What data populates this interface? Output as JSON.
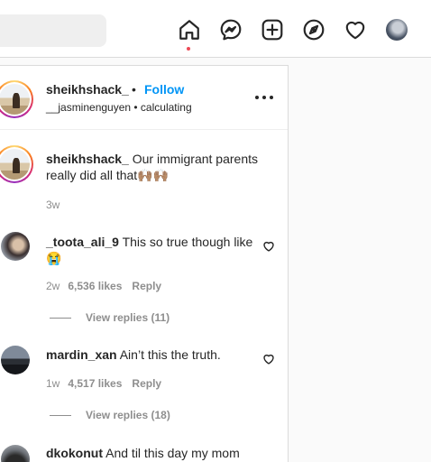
{
  "topbar": {
    "icons": [
      "home-icon",
      "messenger-icon",
      "new-post-icon",
      "explore-icon",
      "activity-heart-icon",
      "profile-avatar"
    ]
  },
  "post": {
    "header": {
      "username": "sheikhshack_",
      "separator": "•",
      "follow_label": "Follow",
      "subtitle": "__jasminenguyen • calculating"
    },
    "caption": {
      "username": "sheikhshack_",
      "text": "Our immigrant parents really did all that🙌🏽🙌🏽",
      "time": "3w"
    },
    "comments": [
      {
        "username": "_toota_ali_9",
        "text": "This so true though like 😭",
        "time": "2w",
        "likes": "6,536 likes",
        "reply_label": "Reply",
        "view_replies": "View replies (11)"
      },
      {
        "username": "mardin_xan",
        "text": "Ain’t this the truth.",
        "time": "1w",
        "likes": "4,517 likes",
        "reply_label": "Reply",
        "view_replies": "View replies (18)"
      },
      {
        "username": "dkokonut",
        "text": "And til this day my mom"
      }
    ]
  },
  "colors": {
    "accent": "#0095f6",
    "notification_dot": "#ed4956",
    "muted_text": "#8e8e8e",
    "border": "#dbdbdb"
  }
}
